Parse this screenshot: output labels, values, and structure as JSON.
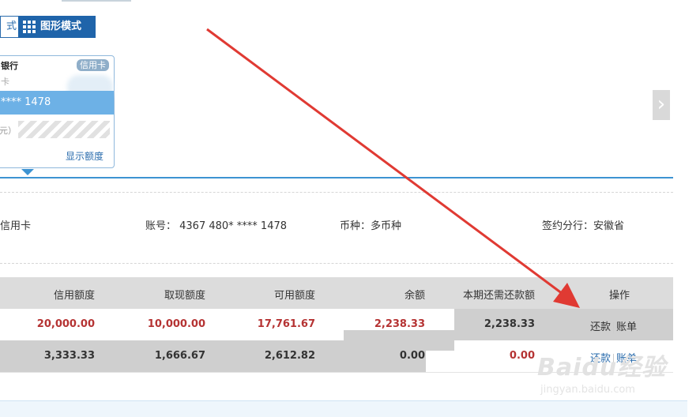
{
  "mode_toggle": {
    "list_label": "式",
    "graph_label": "图形模式"
  },
  "card": {
    "bank_name": "银行",
    "type_badge": "信用卡",
    "sub_label": "卡",
    "number": "**** 1478",
    "label2": "元）",
    "show_quota_link": "显示额度"
  },
  "info": {
    "card_name": "信用卡",
    "account": "账号：  4367 480* **** 1478",
    "currency": "币种：多币种",
    "branch": "签约分行：安徽省"
  },
  "table": {
    "headers": [
      "信用额度",
      "取现额度",
      "可用额度",
      "余额",
      "本期还需还款额",
      "操作"
    ],
    "rows": [
      {
        "credit": "20,000.00",
        "cash": "10,000.00",
        "available": "17,761.67",
        "balance": "2,238.33",
        "due": "2,238.33",
        "op_pay": "还款",
        "op_bill": "账单"
      },
      {
        "credit": "3,333.33",
        "cash": "1,666.67",
        "available": "2,612.82",
        "balance": "0.00",
        "due": "0.00",
        "op_pay": "还款",
        "op_bill": "账单"
      }
    ]
  },
  "watermark": {
    "brand": "Baidu经验",
    "url": "jingyan.baidu.com"
  },
  "colors": {
    "accent": "#1f64aa",
    "card_highlight": "#6db1e6",
    "amount_red": "#b53333",
    "annotation_arrow": "#e03a33"
  }
}
